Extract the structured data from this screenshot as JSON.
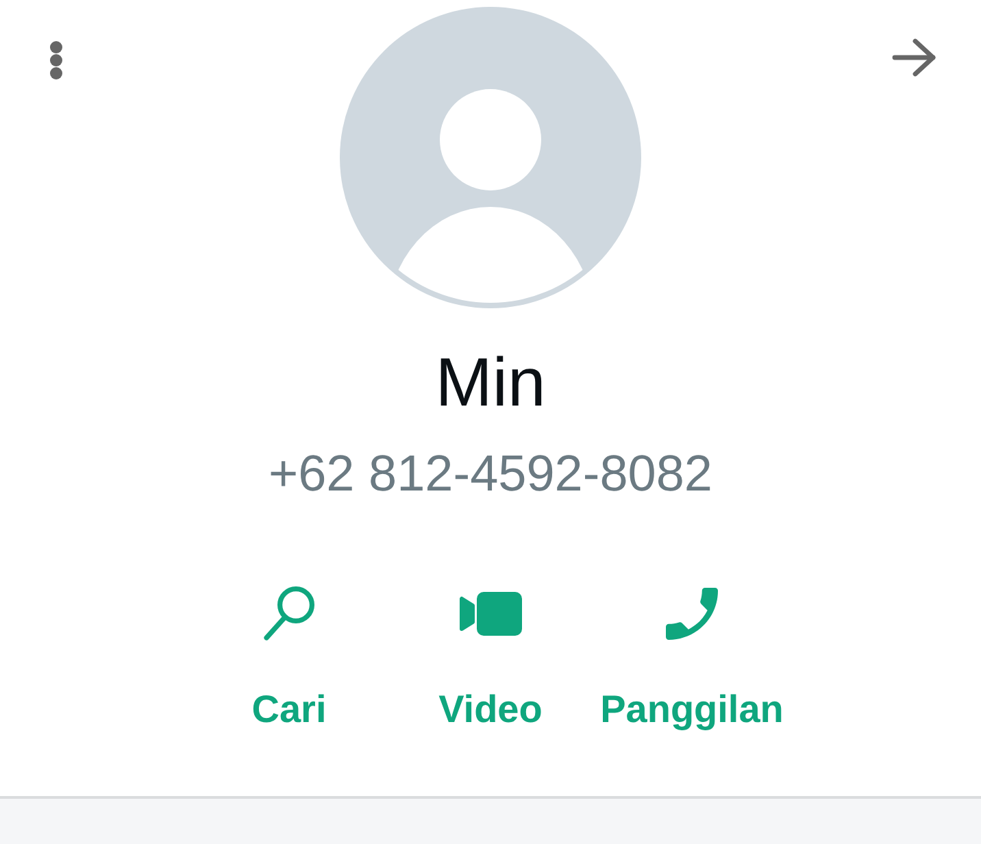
{
  "contact": {
    "name": "Min",
    "phone": "+62 812-4592-8082"
  },
  "actions": [
    {
      "kind": "search",
      "label": "Cari"
    },
    {
      "kind": "video",
      "label": "Video"
    },
    {
      "kind": "call",
      "label": "Panggilan"
    }
  ]
}
